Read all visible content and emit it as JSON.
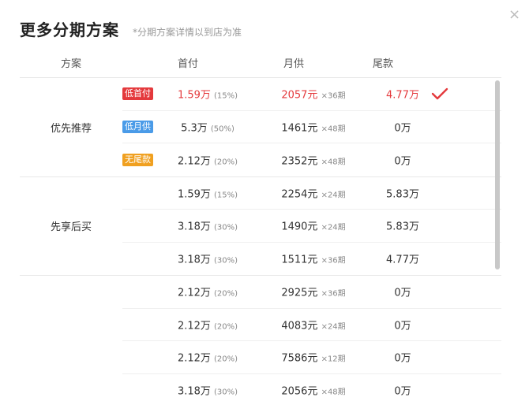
{
  "dialog": {
    "title": "更多分期方案",
    "subtitle": "*分期方案详情以到店为准",
    "close_icon": "×"
  },
  "columns": {
    "plan": "方案",
    "down": "首付",
    "monthly": "月供",
    "tail": "尾款"
  },
  "colors": {
    "accent_red": "#e4393c",
    "badge_red": "#e4393c",
    "badge_blue": "#4a9be8",
    "badge_orange": "#f0a020"
  },
  "groups": [
    {
      "name": "优先推荐",
      "rows": [
        {
          "badge": "低首付",
          "badge_color": "#e4393c",
          "down": "1.59万",
          "down_pct": "(15%)",
          "monthly": "2057元",
          "term": "×36期",
          "tail": "4.77万",
          "selected": true
        },
        {
          "badge": "低月供",
          "badge_color": "#4a9be8",
          "down": "5.3万",
          "down_pct": "(50%)",
          "monthly": "1461元",
          "term": "×48期",
          "tail": "0万",
          "selected": false
        },
        {
          "badge": "无尾款",
          "badge_color": "#f0a020",
          "down": "2.12万",
          "down_pct": "(20%)",
          "monthly": "2352元",
          "term": "×48期",
          "tail": "0万",
          "selected": false
        }
      ]
    },
    {
      "name": "先享后买",
      "rows": [
        {
          "badge": "",
          "down": "1.59万",
          "down_pct": "(15%)",
          "monthly": "2254元",
          "term": "×24期",
          "tail": "5.83万",
          "selected": false
        },
        {
          "badge": "",
          "down": "3.18万",
          "down_pct": "(30%)",
          "monthly": "1490元",
          "term": "×24期",
          "tail": "5.83万",
          "selected": false
        },
        {
          "badge": "",
          "down": "3.18万",
          "down_pct": "(30%)",
          "monthly": "1511元",
          "term": "×36期",
          "tail": "4.77万",
          "selected": false
        }
      ]
    },
    {
      "name": "",
      "rows": [
        {
          "badge": "",
          "down": "2.12万",
          "down_pct": "(20%)",
          "monthly": "2925元",
          "term": "×36期",
          "tail": "0万",
          "selected": false
        },
        {
          "badge": "",
          "down": "2.12万",
          "down_pct": "(20%)",
          "monthly": "4083元",
          "term": "×24期",
          "tail": "0万",
          "selected": false
        },
        {
          "badge": "",
          "down": "2.12万",
          "down_pct": "(20%)",
          "monthly": "7586元",
          "term": "×12期",
          "tail": "0万",
          "selected": false
        },
        {
          "badge": "",
          "down": "3.18万",
          "down_pct": "(30%)",
          "monthly": "2056元",
          "term": "×48期",
          "tail": "0万",
          "selected": false
        }
      ]
    }
  ]
}
